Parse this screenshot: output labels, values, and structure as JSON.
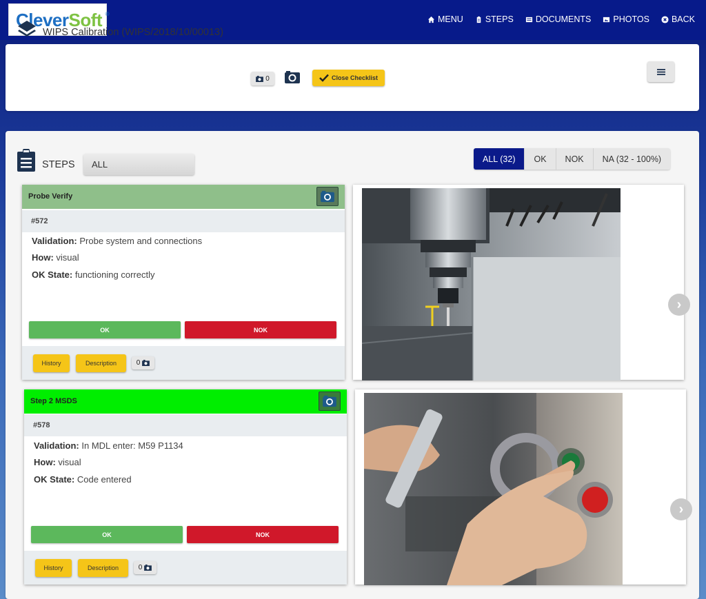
{
  "brand": {
    "logo_main": "Clever",
    "logo_accent": "Soft",
    "logo_mark": "®"
  },
  "nav": [
    {
      "label": "MENU",
      "icon": "home-icon"
    },
    {
      "label": "STEPS",
      "icon": "clipboard-icon"
    },
    {
      "label": "DOCUMENTS",
      "icon": "document-icon"
    },
    {
      "label": "PHOTOS",
      "icon": "photo-icon"
    },
    {
      "label": "BACK",
      "icon": "close-circle-icon"
    }
  ],
  "header": {
    "title": "WIPS Calibration (WIPS/2018/10/00013)",
    "photo_count": "0",
    "close_checklist_label": "Close Checklist"
  },
  "steps_section": {
    "label": "STEPS",
    "select_value": "ALL",
    "filters": [
      "ALL (32)",
      "OK",
      "NOK",
      "NA (32 - 100%)"
    ],
    "active_filter": "ALL (32)"
  },
  "steps": [
    {
      "title": "Probe Verify",
      "header_color": "#8fbf8a",
      "number": "#572",
      "validation_label": "Validation:",
      "validation": "Probe system and connections",
      "how_label": "How:",
      "how": "visual",
      "ok_state_label": "OK State:",
      "ok_state": "functioning correctly",
      "ok_label": "OK",
      "nok_label": "NOK",
      "history_label": "History",
      "description_label": "Description",
      "photo_count": "0"
    },
    {
      "title": "Step 2 MSDS",
      "header_color": "#00ee00",
      "number": "#578",
      "validation_label": "Validation:",
      "validation": "In MDL enter: M59 P1134",
      "how_label": "How:",
      "how": "visual",
      "ok_state_label": "OK State:",
      "ok_state": "Code entered",
      "ok_label": "OK",
      "nok_label": "NOK",
      "history_label": "History",
      "description_label": "Description",
      "photo_count": "0"
    }
  ],
  "colors": {
    "navbar": "#071a8a",
    "ok": "#5cb85c",
    "nok": "#d0182a",
    "accent_yellow": "#f5c518",
    "filter_active": "#0b1a8a"
  }
}
